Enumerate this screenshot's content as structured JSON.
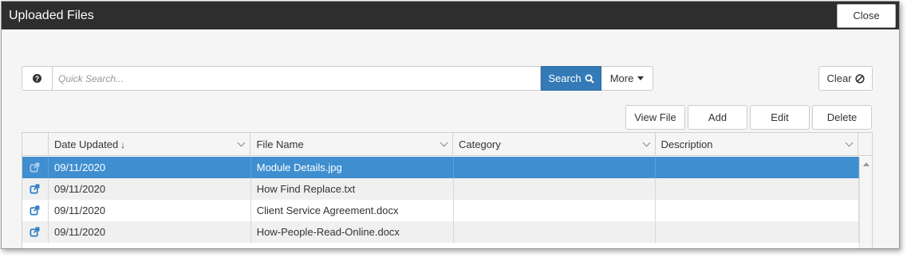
{
  "dialog": {
    "title": "Uploaded Files",
    "close_label": "Close"
  },
  "search": {
    "help_glyph": "?",
    "placeholder": "Quick Search...",
    "search_label": "Search",
    "more_label": "More",
    "clear_label": "Clear"
  },
  "actions": {
    "view_file": "View File",
    "add": "Add",
    "edit": "Edit",
    "delete": "Delete"
  },
  "grid": {
    "columns": [
      "Date Updated",
      "File Name",
      "Category",
      "Description"
    ],
    "sort_indicator": "↓",
    "rows": [
      {
        "date": "09/11/2020",
        "file_name": "Module Details.jpg",
        "category": "",
        "description": ""
      },
      {
        "date": "09/11/2020",
        "file_name": "How Find Replace.txt",
        "category": "",
        "description": ""
      },
      {
        "date": "09/11/2020",
        "file_name": "Client Service Agreement.docx",
        "category": "",
        "description": ""
      },
      {
        "date": "09/11/2020",
        "file_name": "How-People-Read-Online.docx",
        "category": "",
        "description": ""
      }
    ]
  },
  "icons": {
    "help": "question-circle-icon",
    "search": "magnifier-icon",
    "more": "caret-down-icon",
    "clear": "ban-icon",
    "row_action": "external-link-icon",
    "column_menu": "chevron-down-icon"
  },
  "colors": {
    "title_bar": "#2e2e2e",
    "primary": "#337ab7",
    "selected_row": "#3f8ed0",
    "row_icon": "#2b7bc4"
  }
}
